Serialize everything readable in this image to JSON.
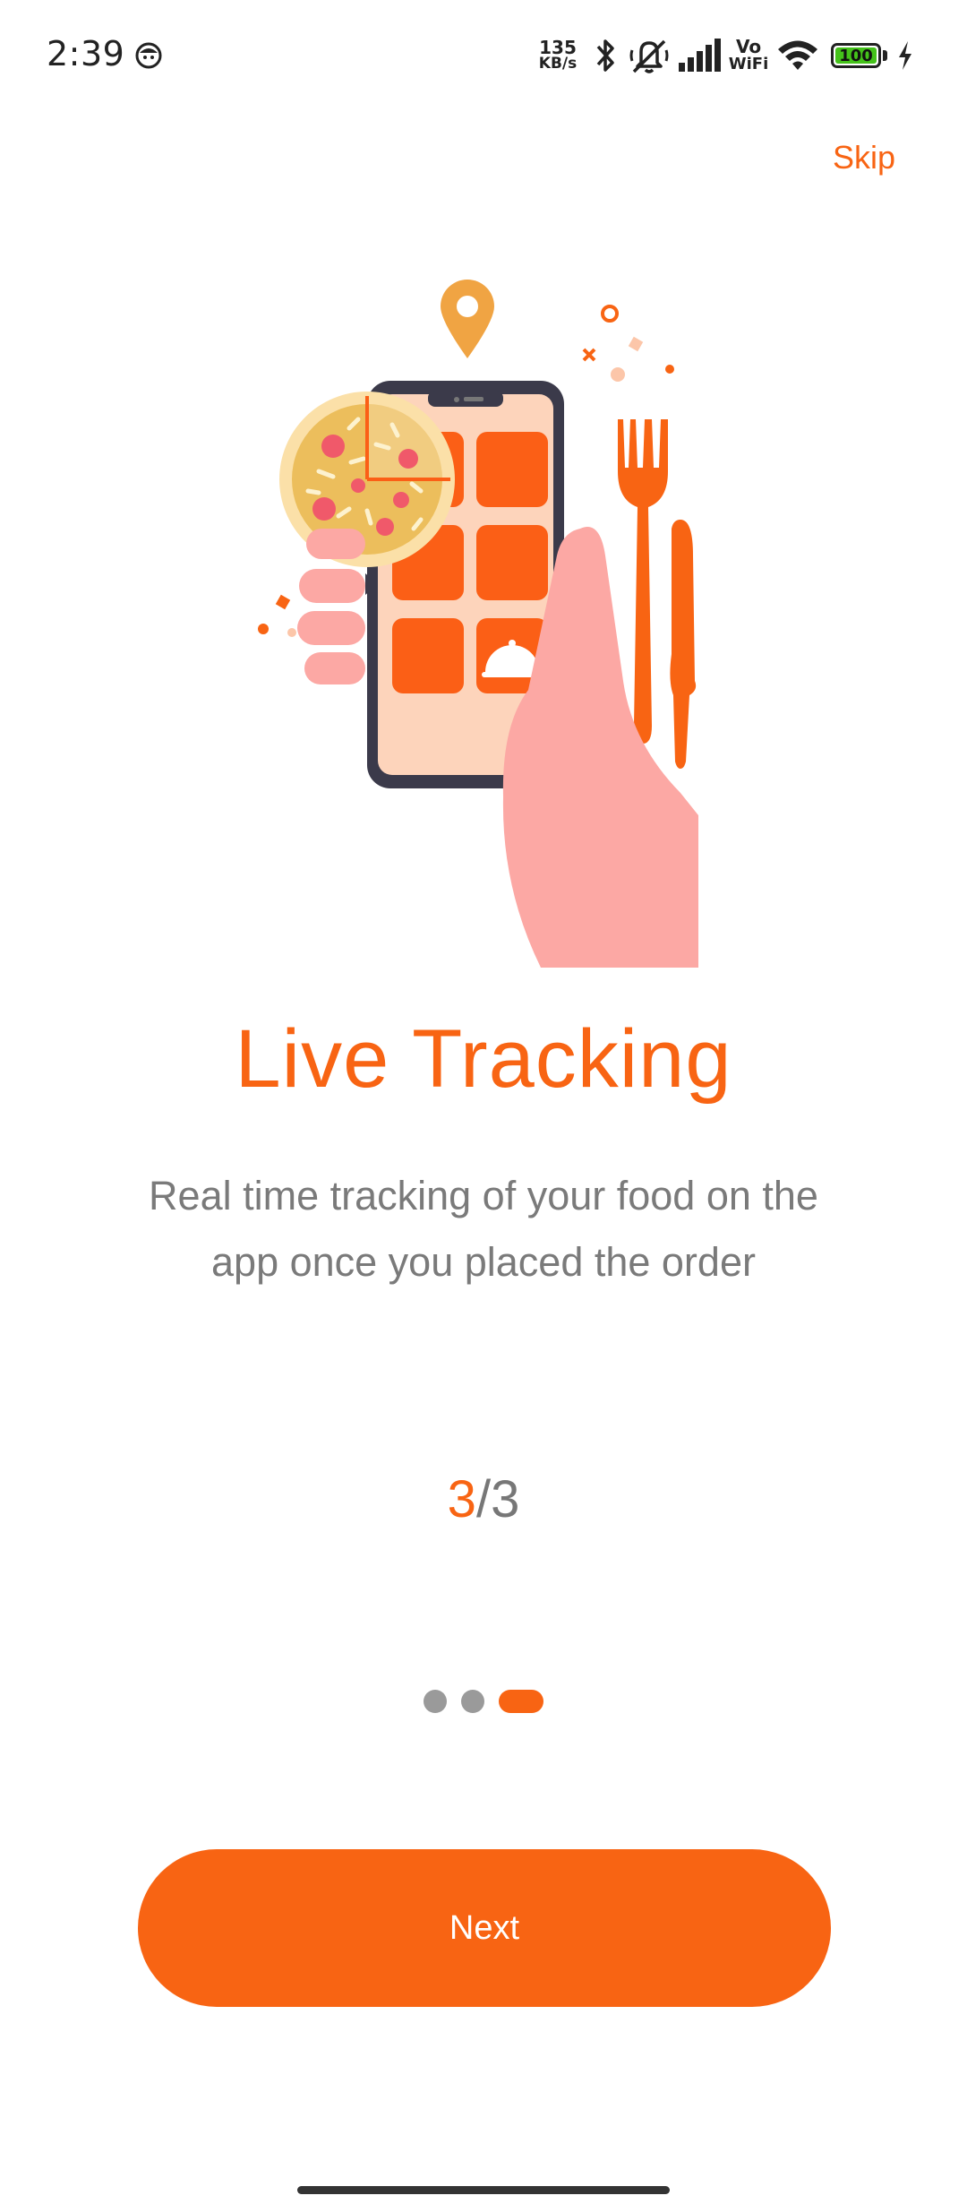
{
  "status_bar": {
    "time": "2:39",
    "net_speed_value": "135",
    "net_speed_unit": "KB/s",
    "volte_top": "Vo",
    "volte_bottom": "WiFi",
    "battery": "100",
    "icons": [
      "face-icon",
      "bluetooth-icon",
      "mute-icon",
      "signal-icon",
      "wifi-icon",
      "battery-icon",
      "charging-icon"
    ]
  },
  "header": {
    "skip_label": "Skip"
  },
  "onboarding": {
    "title": "Live Tracking",
    "description": "Real time tracking of your food on the app once you placed the order",
    "page_current": "3",
    "page_separator": "/",
    "page_total": "3",
    "dots": 3,
    "active_dot": 3
  },
  "actions": {
    "next_label": "Next"
  },
  "colors": {
    "accent": "#f86413",
    "text_muted": "#7a7a7a",
    "dot_inactive": "#9a9a9a",
    "background": "#ffffff"
  }
}
